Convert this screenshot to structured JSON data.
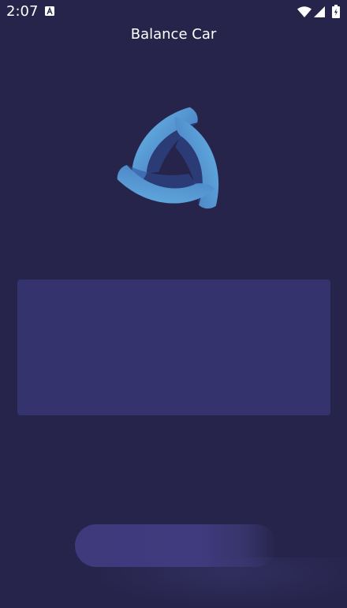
{
  "status_bar": {
    "time": "2:07",
    "icons": [
      "notification-a-icon",
      "wifi-icon",
      "cell-signal-icon",
      "battery-icon"
    ]
  },
  "header": {
    "title": "Balance Car"
  },
  "logo": {
    "icon": "triskelion-logo"
  },
  "colors": {
    "background": "#26244b",
    "panel": "#34336d",
    "button": "#3f3b7e",
    "logo_light": "#5eb0e3",
    "logo_dark": "#3557a8"
  }
}
